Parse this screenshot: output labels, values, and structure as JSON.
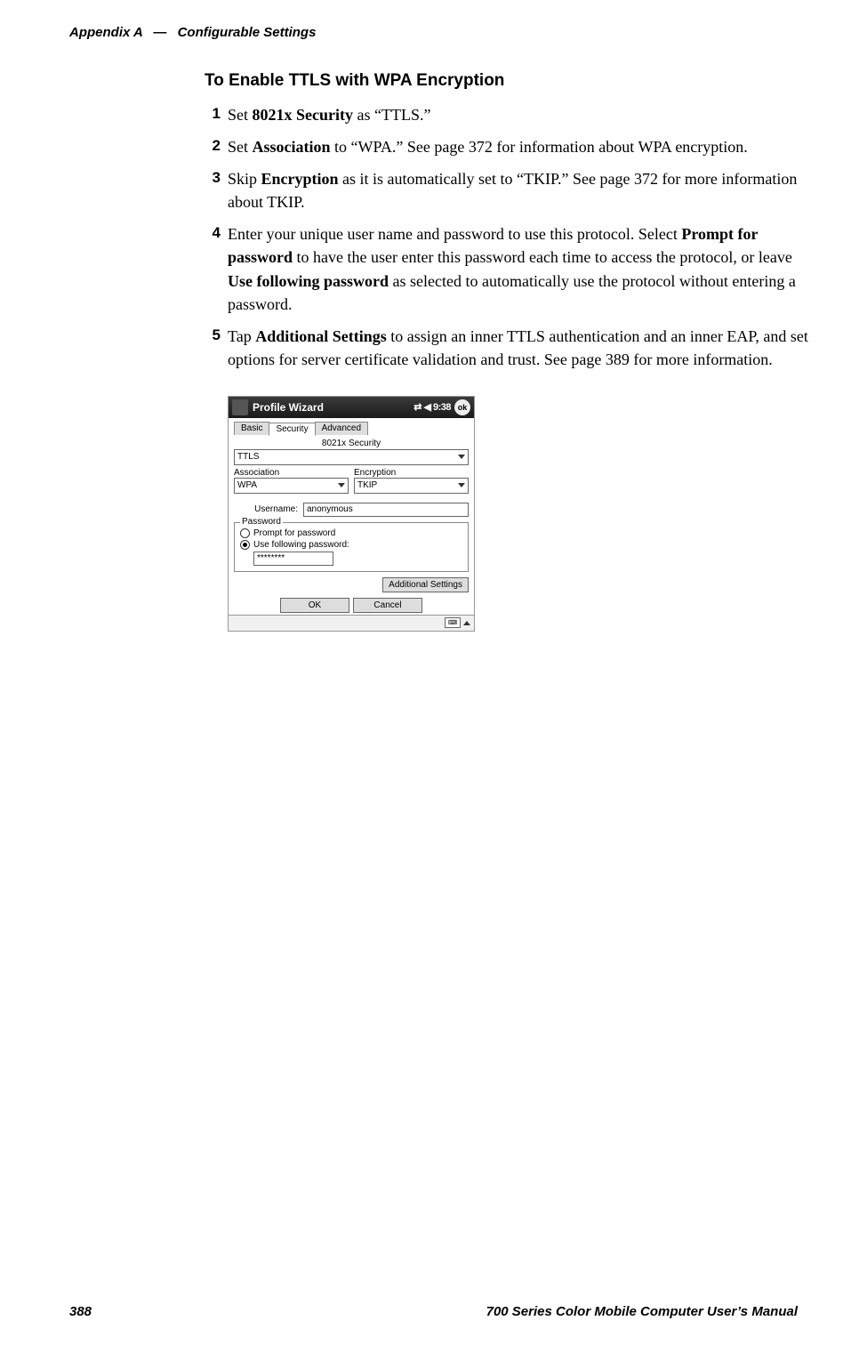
{
  "header": {
    "appendix": "Appendix  A",
    "dash": "—",
    "title": "Configurable Settings"
  },
  "section_title": "To Enable TTLS with WPA Encryption",
  "steps": [
    {
      "num": "1",
      "parts": [
        {
          "t": "Set "
        },
        {
          "t": "8021x Security",
          "b": true
        },
        {
          "t": " as “TTLS.”"
        }
      ]
    },
    {
      "num": "2",
      "parts": [
        {
          "t": "Set "
        },
        {
          "t": "Association",
          "b": true
        },
        {
          "t": " to “WPA.” See page 372 for information about WPA encryption."
        }
      ]
    },
    {
      "num": "3",
      "parts": [
        {
          "t": "Skip "
        },
        {
          "t": "Encryption",
          "b": true
        },
        {
          "t": " as it is automatically set to “TKIP.” See page 372 for more information about TKIP."
        }
      ]
    },
    {
      "num": "4",
      "parts": [
        {
          "t": "Enter your unique user name and password to use this protocol. Select "
        },
        {
          "t": "Prompt for password",
          "b": true
        },
        {
          "t": " to have the user enter this password each time to access the protocol, or leave "
        },
        {
          "t": "Use following password",
          "b": true
        },
        {
          "t": " as selected to automatically use the protocol without entering a password."
        }
      ]
    },
    {
      "num": "5",
      "parts": [
        {
          "t": "Tap "
        },
        {
          "t": "Additional Settings",
          "b": true
        },
        {
          "t": " to assign an inner TTLS authentication and an inner EAP, and set options for server certificate validation and trust. See page 389 for more information."
        }
      ]
    }
  ],
  "screenshot": {
    "window_title": "Profile Wizard",
    "status_time": "⇄ ◀ 9:38",
    "ok_circle": "ok",
    "tabs": [
      "Basic",
      "Security",
      "Advanced"
    ],
    "active_tab_index": 1,
    "lbl_8021x": "8021x Security",
    "val_8021x": "TTLS",
    "lbl_assoc": "Association",
    "val_assoc": "WPA",
    "lbl_enc": "Encryption",
    "val_enc": "TKIP",
    "lbl_user": "Username:",
    "val_user": "anonymous",
    "legend_pwd": "Password",
    "radio_prompt": "Prompt for password",
    "radio_use": "Use following password:",
    "val_pwd": "********",
    "btn_addl": "Additional Settings",
    "btn_ok": "OK",
    "btn_cancel": "Cancel"
  },
  "footer": {
    "page": "388",
    "manual": "700 Series Color Mobile Computer User’s Manual"
  }
}
